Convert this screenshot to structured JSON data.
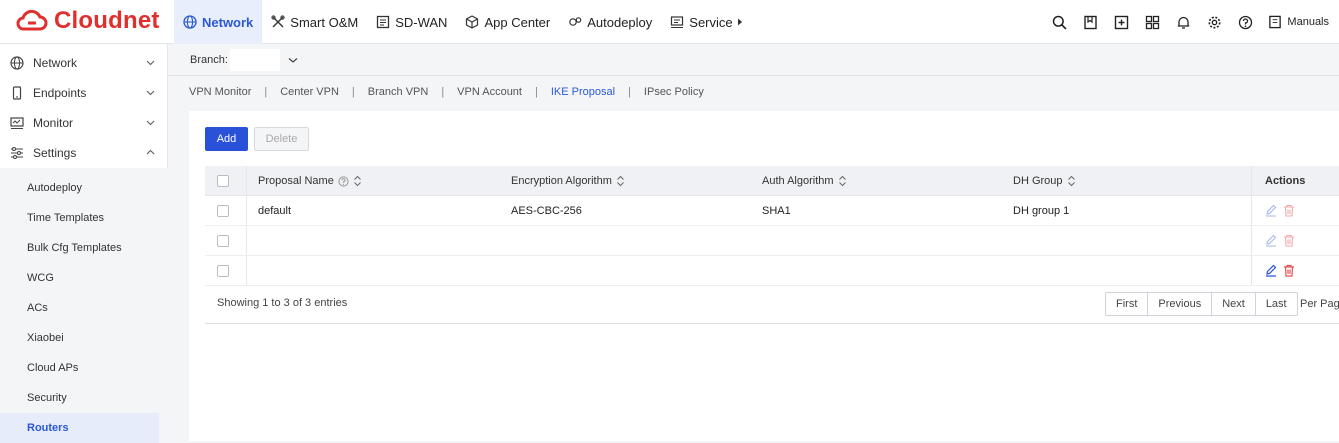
{
  "app": {
    "name": "Cloudnet"
  },
  "nav": {
    "items": [
      {
        "label": "Network",
        "icon": "globe-icon",
        "active": true
      },
      {
        "label": "Smart O&M",
        "icon": "tools-icon"
      },
      {
        "label": "SD-WAN",
        "icon": "sdwan-icon"
      },
      {
        "label": "App Center",
        "icon": "cube-icon"
      },
      {
        "label": "Autodeploy",
        "icon": "autodeploy-icon"
      },
      {
        "label": "Service",
        "icon": "service-icon"
      }
    ],
    "manuals_label": "Manuals"
  },
  "sidebar": {
    "groups": [
      {
        "label": "Network",
        "icon": "globe-icon"
      },
      {
        "label": "Endpoints",
        "icon": "phone-icon"
      },
      {
        "label": "Monitor",
        "icon": "monitor-icon"
      },
      {
        "label": "Settings",
        "icon": "settings-icon"
      }
    ],
    "settings_items": [
      "Autodeploy",
      "Time Templates",
      "Bulk Cfg Templates",
      "WCG",
      "ACs",
      "Xiaobei",
      "Cloud APs",
      "Security",
      "Routers"
    ],
    "active_item": "Routers"
  },
  "branch": {
    "label": "Branch:",
    "value": ""
  },
  "subtabs": {
    "items": [
      "VPN Monitor",
      "Center VPN",
      "Branch VPN",
      "VPN Account",
      "IKE Proposal",
      "IPsec Policy"
    ],
    "active": "IKE Proposal"
  },
  "toolbar": {
    "add_label": "Add",
    "delete_label": "Delete"
  },
  "table": {
    "columns": [
      "Proposal Name",
      "Encryption Algorithm",
      "Auth Algorithm",
      "DH Group",
      "Actions"
    ],
    "rows": [
      {
        "name": "default",
        "encryption": "AES-CBC-256",
        "auth": "SHA1",
        "dh": "DH group 1"
      },
      {
        "name": "",
        "encryption": "",
        "auth": "",
        "dh": ""
      },
      {
        "name": "",
        "encryption": "",
        "auth": "",
        "dh": ""
      }
    ]
  },
  "footer": {
    "showing": "Showing 1 to 3 of 3 entries",
    "pager": [
      "First",
      "Previous",
      "Next",
      "Last"
    ],
    "per_page_label": "Per Page"
  },
  "colors": {
    "brand": "#e0302e",
    "accent": "#2a52d8",
    "delete_icon": "#e05252"
  }
}
